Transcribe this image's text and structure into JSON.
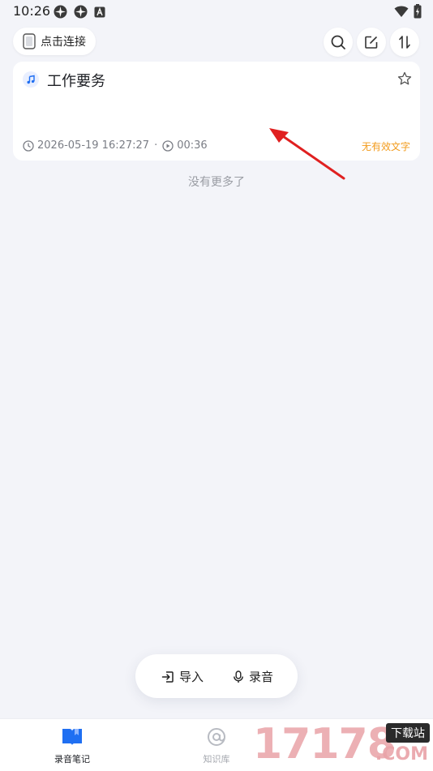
{
  "status_bar": {
    "time": "10:26",
    "left_icons": [
      "app-icon",
      "app-icon",
      "font-icon"
    ],
    "right_icons": [
      "wifi-icon",
      "battery-icon"
    ]
  },
  "header": {
    "connect_label": "点击连接",
    "actions": [
      "search-icon",
      "edit-icon",
      "sort-icon"
    ]
  },
  "recordings": [
    {
      "title": "工作要务",
      "date": "2026-05-19 16:27:27",
      "separator": "·",
      "duration": "00:36",
      "status": "无有效文字",
      "starred": false
    }
  ],
  "list_footer": "没有更多了",
  "actions": {
    "import_label": "导入",
    "record_label": "录音"
  },
  "tabs": [
    {
      "label": "录音笔记",
      "active": true,
      "icon": "book-icon"
    },
    {
      "label": "知识库",
      "active": false,
      "icon": "at-icon"
    }
  ],
  "watermark": {
    "number": "17178",
    "tag": "下载站",
    "suffix": ".COM"
  },
  "colors": {
    "background": "#f3f4f9",
    "accent_blue": "#1f6ff2",
    "warning_orange": "#f29a1a",
    "annotation_red": "#e02020"
  }
}
